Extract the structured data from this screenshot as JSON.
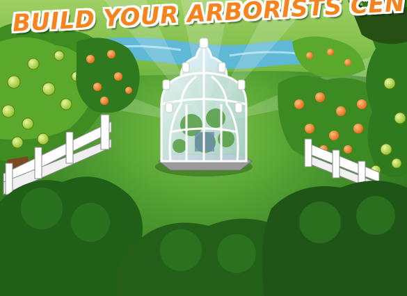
{
  "banner": {
    "title": "BUILD YOUR ARBORISTS CENTER!"
  },
  "colors": {
    "title_fill": "#f7831e",
    "title_outline": "#ffffff",
    "lawn": "#3f8f2b",
    "river": "#5fb8d6",
    "foliage_dark": "#1f5f17"
  },
  "scene": {
    "objects": [
      "greenhouse-building",
      "apple-tree",
      "orange-tree",
      "white-fence",
      "river",
      "bushes"
    ]
  }
}
